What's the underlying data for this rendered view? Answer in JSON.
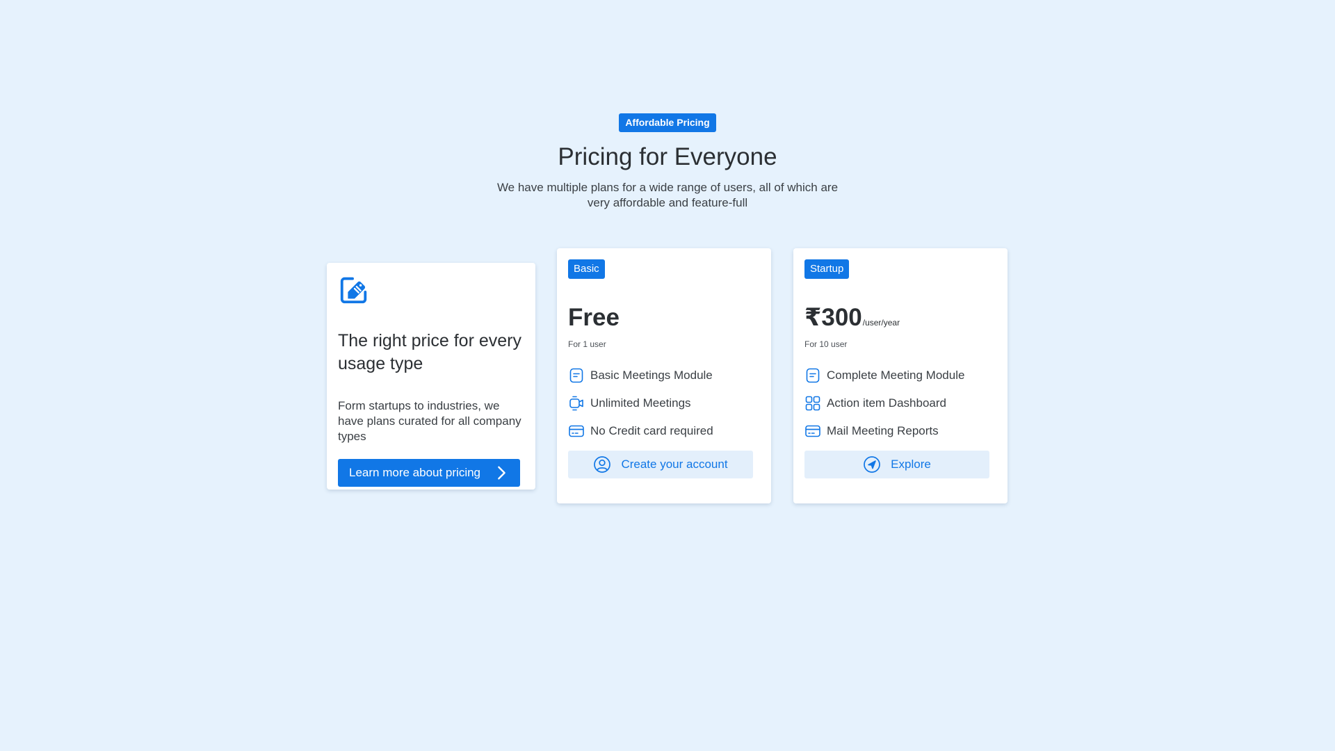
{
  "header": {
    "eyebrow": "Affordable Pricing",
    "title": "Pricing for Everyone",
    "subtitle": "We have multiple plans for a wide range of users, all of which are very affordable and feature-full"
  },
  "intro_card": {
    "icon": "price-tag-icon",
    "title": "The right price for every usage type",
    "text": "Form startups to industries, we have plans curated for all company types",
    "button_label": "Learn more about pricing",
    "button_icon": "chevron-right-icon"
  },
  "plans": [
    {
      "badge": "Basic",
      "price": "Free",
      "price_unit": "",
      "users": "For 1 user",
      "features": [
        {
          "icon": "note-icon",
          "label": "Basic Meetings Module"
        },
        {
          "icon": "video-icon",
          "label": "Unlimited Meetings"
        },
        {
          "icon": "credit-card-icon",
          "label": "No Credit card required"
        }
      ],
      "button_label": "Create your account",
      "button_icon": "user-circle-icon"
    },
    {
      "badge": "Startup",
      "price": "₹300",
      "price_unit": "/user/year",
      "users": "For 10 user",
      "features": [
        {
          "icon": "note-icon",
          "label": "Complete Meeting Module"
        },
        {
          "icon": "dashboard-grid-icon",
          "label": "Action item Dashboard"
        },
        {
          "icon": "credit-card-icon",
          "label": "Mail Meeting Reports"
        }
      ],
      "button_label": "Explore",
      "button_icon": "compass-icon"
    }
  ],
  "colors": {
    "background": "#e6f2fd",
    "accent": "#1177e6",
    "secondary_button_bg": "#e3effb",
    "card": "#ffffff",
    "text": "#2b2f33"
  }
}
